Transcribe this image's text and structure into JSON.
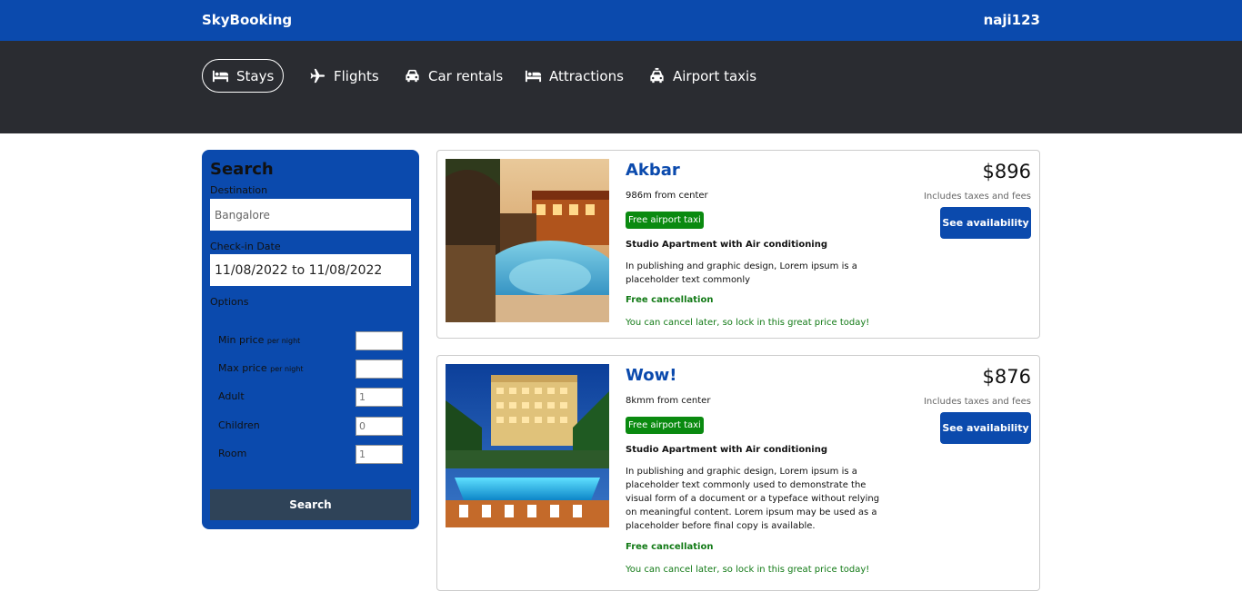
{
  "header": {
    "brand": "SkyBooking",
    "username": "naji123"
  },
  "nav": {
    "items": [
      {
        "label": "Stays",
        "icon": "bed-icon",
        "active": true
      },
      {
        "label": "Flights",
        "icon": "plane-icon"
      },
      {
        "label": "Car rentals",
        "icon": "car-icon"
      },
      {
        "label": "Attractions",
        "icon": "bed-icon"
      },
      {
        "label": "Airport taxis",
        "icon": "taxi-icon"
      }
    ]
  },
  "search": {
    "title": "Search",
    "destination_label": "Destination",
    "destination_placeholder": "Bangalore",
    "checkin_label": "Check-in Date",
    "dates_value": "11/08/2022 to 11/08/2022",
    "options_label": "Options",
    "options": [
      {
        "label": "Min price",
        "hint": "per night",
        "placeholder": ""
      },
      {
        "label": "Max price",
        "hint": "per night",
        "placeholder": ""
      },
      {
        "label": "Adult",
        "hint": "",
        "placeholder": "1"
      },
      {
        "label": "Children",
        "hint": "",
        "placeholder": "0"
      },
      {
        "label": "Room",
        "hint": "",
        "placeholder": "1"
      }
    ],
    "button_label": "Search"
  },
  "results": [
    {
      "title": "Akbar",
      "distance": "986m from center",
      "taxi_badge": "Free airport taxi",
      "subtitle": "Studio Apartment with Air conditioning",
      "description": "In publishing and graphic design, Lorem ipsum is a placeholder text commonly",
      "cancellation": "Free cancellation",
      "cancellation_sub": "You can cancel later, so lock in this great price today!",
      "price": "$896",
      "tax_note": "Includes taxes and fees",
      "button_label": "See availability"
    },
    {
      "title": "Wow!",
      "distance": "8kmm from center",
      "taxi_badge": "Free airport taxi",
      "subtitle": "Studio Apartment with Air conditioning",
      "description": "In publishing and graphic design, Lorem ipsum is a placeholder text commonly used to demonstrate the visual form of a document or a typeface without relying on meaningful content. Lorem ipsum may be used as a placeholder before final copy is available.",
      "cancellation": "Free cancellation",
      "cancellation_sub": "You can cancel later, so lock in this great price today!",
      "price": "$876",
      "tax_note": "Includes taxes and fees",
      "button_label": "See availability"
    }
  ],
  "colors": {
    "brand_blue": "#0b4aad",
    "nav_dark": "#2a2c31",
    "badge_green": "#0a8a10",
    "search_button": "#2f4358"
  }
}
